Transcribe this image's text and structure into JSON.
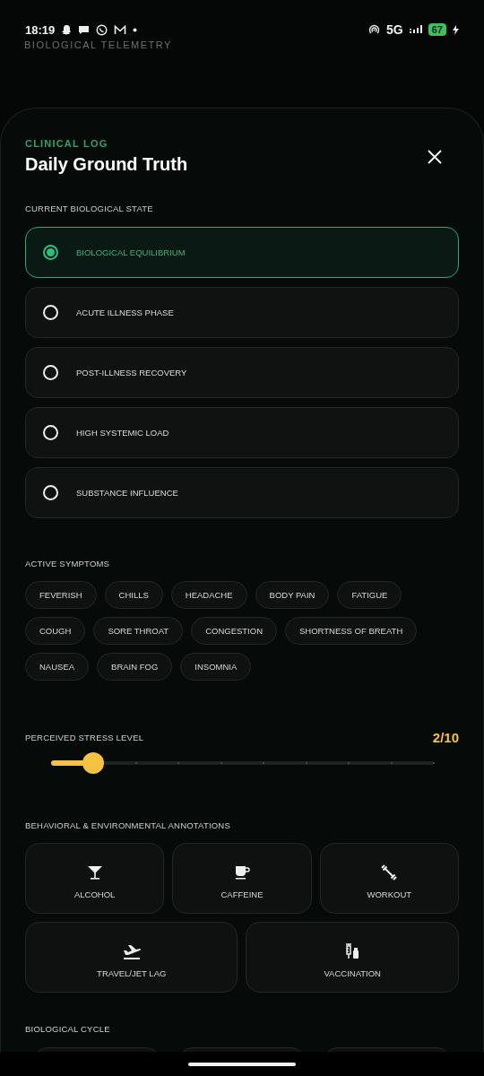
{
  "status_bar": {
    "time": "18:19",
    "network": "5G",
    "battery": "67"
  },
  "background": {
    "app_title": "BIOLOGICAL TELEMETRY"
  },
  "sheet": {
    "eyebrow": "CLINICAL LOG",
    "title": "Daily Ground Truth",
    "state_section": {
      "label": "CURRENT BIOLOGICAL STATE",
      "options": [
        {
          "label": "BIOLOGICAL EQUILIBRIUM",
          "selected": true
        },
        {
          "label": "ACUTE ILLNESS PHASE",
          "selected": false
        },
        {
          "label": "POST-ILLNESS RECOVERY",
          "selected": false
        },
        {
          "label": "HIGH SYSTEMIC LOAD",
          "selected": false
        },
        {
          "label": "SUBSTANCE INFLUENCE",
          "selected": false
        }
      ]
    },
    "symptoms_section": {
      "label": "ACTIVE SYMPTOMS",
      "chips": [
        {
          "label": "FEVERISH",
          "selected": false
        },
        {
          "label": "CHILLS",
          "selected": false
        },
        {
          "label": "HEADACHE",
          "selected": false
        },
        {
          "label": "BODY PAIN",
          "selected": false
        },
        {
          "label": "FATIGUE",
          "selected": false
        },
        {
          "label": "COUGH",
          "selected": false
        },
        {
          "label": "SORE THROAT",
          "selected": false
        },
        {
          "label": "CONGESTION",
          "selected": false
        },
        {
          "label": "SHORTNESS OF BREATH",
          "selected": false
        },
        {
          "label": "NAUSEA",
          "selected": false
        },
        {
          "label": "BRAIN FOG",
          "selected": false
        },
        {
          "label": "INSOMNIA",
          "selected": false
        }
      ]
    },
    "stress_section": {
      "label": "PERCEIVED STRESS LEVEL",
      "reading": "2/10",
      "level": 0.111
    },
    "annotations_section": {
      "label": "BEHAVIORAL & ENVIRONMENTAL ANNOTATIONS",
      "tiles": [
        {
          "kind": "alcohol",
          "label": "ALCOHOL",
          "selected": false
        },
        {
          "kind": "caffeine",
          "label": "CAFFEINE",
          "selected": false
        },
        {
          "kind": "workout",
          "label": "WORKOUT",
          "selected": false
        },
        {
          "kind": "travel",
          "label": "TRAVEL/JET LAG",
          "selected": false
        },
        {
          "kind": "vaccination",
          "label": "VACCINATION",
          "selected": false
        }
      ]
    },
    "cycle_section": {
      "label": "BIOLOGICAL CYCLE"
    }
  }
}
